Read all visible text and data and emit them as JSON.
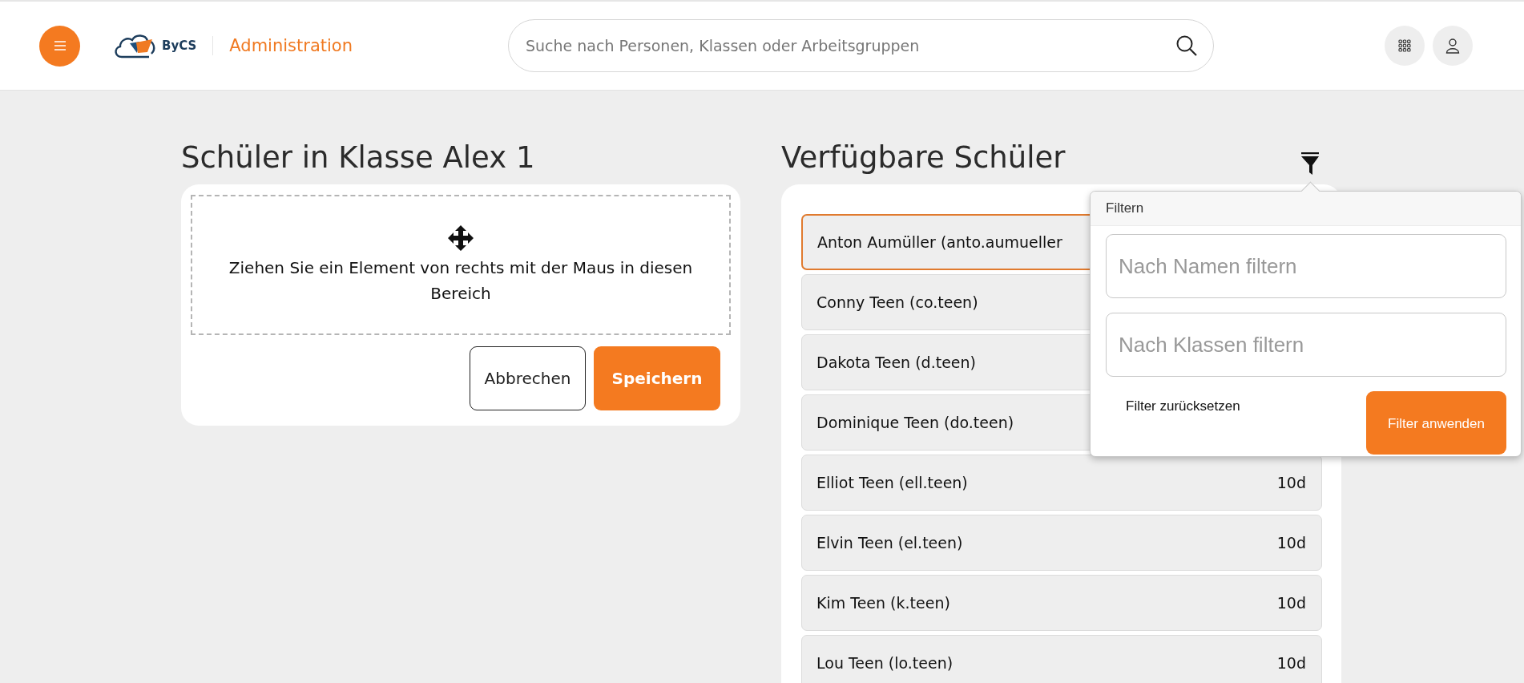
{
  "header": {
    "logo_text": "ByCS",
    "app_title": "Administration",
    "search": {
      "placeholder": "Suche nach Personen, Klassen oder Arbeitsgruppen"
    }
  },
  "assigned": {
    "title": "Schüler in Klasse Alex 1",
    "dropzone_text": "Ziehen Sie ein Element von rechts mit der Maus in diesen Bereich",
    "buttons": [
      {
        "label": "Abbrechen",
        "kind": "secondary"
      },
      {
        "label": "Speichern",
        "kind": "primary"
      }
    ]
  },
  "available": {
    "title": "Verfügbare Schüler",
    "students": [
      {
        "name": "Anton Aumüller (anto.aumueller",
        "selected": true
      },
      {
        "name": "Conny Teen (co.teen)",
        "selected": false
      },
      {
        "name": "Dakota Teen (d.teen)",
        "selected": false
      },
      {
        "name": "Dominique Teen (do.teen)",
        "selected": false
      },
      {
        "name": "Elliot Teen (ell.teen)",
        "class": "10d",
        "selected": false
      },
      {
        "name": "Elvin Teen (el.teen)",
        "class": "10d",
        "selected": false
      },
      {
        "name": "Kim Teen (k.teen)",
        "class": "10d",
        "selected": false
      },
      {
        "name": "Lou Teen (lo.teen)",
        "class": "10d",
        "selected": false
      }
    ]
  },
  "filter_popover": {
    "title": "Filtern",
    "fields": [
      {
        "placeholder": "Nach Namen filtern"
      },
      {
        "placeholder": "Nach Klassen filtern"
      }
    ],
    "reset_label": "Filter zurücksetzen",
    "apply_label": "Filter anwenden"
  }
}
